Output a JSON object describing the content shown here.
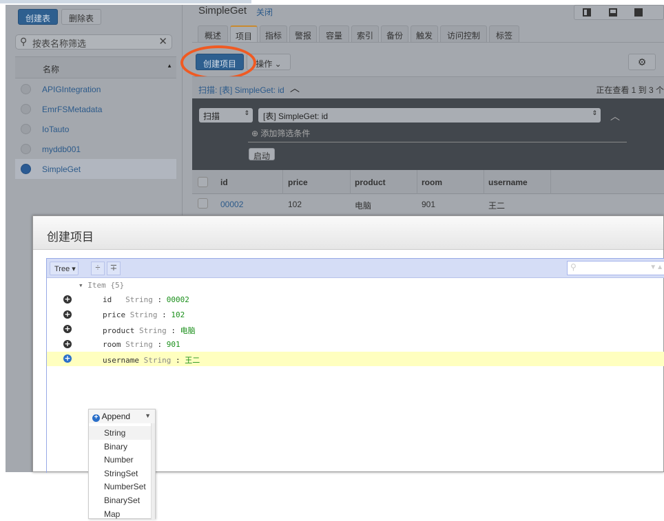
{
  "sidebar": {
    "create_table": "创建表",
    "delete_table": "删除表",
    "filter_placeholder": "按表名称筛选",
    "column_name": "名称",
    "tables": [
      {
        "name": "APIGIntegration",
        "selected": false
      },
      {
        "name": "EmrFSMetadata",
        "selected": false
      },
      {
        "name": "IoTauto",
        "selected": false
      },
      {
        "name": "myddb001",
        "selected": false
      },
      {
        "name": "SimpleGet",
        "selected": true
      }
    ]
  },
  "main": {
    "table_title": "SimpleGet",
    "close_link": "关闭",
    "tabs": [
      {
        "label": "概述"
      },
      {
        "label": "项目",
        "active": true
      },
      {
        "label": "指标"
      },
      {
        "label": "警报"
      },
      {
        "label": "容量"
      },
      {
        "label": "索引"
      },
      {
        "label": "备份"
      },
      {
        "label": "触发"
      },
      {
        "label": "访问控制"
      },
      {
        "label": "标签"
      }
    ],
    "create_item": "创建项目",
    "actions": "操作",
    "scan_summary": "扫描: [表] SimpleGet: id",
    "viewing": "正在查看 1 到 3 个",
    "scan_mode": "扫描",
    "scan_target": "[表] SimpleGet: id",
    "add_filter": "添加筛选条件",
    "start": "启动",
    "columns": [
      "id",
      "price",
      "product",
      "room",
      "username"
    ],
    "rows": [
      [
        "00002",
        "102",
        "电脑",
        "901",
        "王二"
      ]
    ]
  },
  "modal": {
    "title": "创建项目",
    "mode": "Tree",
    "root": "Item {5}",
    "fields": [
      {
        "key": "id",
        "type": "String",
        "value": "00002"
      },
      {
        "key": "price",
        "type": "String",
        "value": "102"
      },
      {
        "key": "product",
        "type": "String",
        "value": "电脑"
      },
      {
        "key": "room",
        "type": "String",
        "value": "901"
      },
      {
        "key": "username",
        "type": "String",
        "value": "王二"
      }
    ],
    "menu": {
      "label": "Append",
      "items": [
        "String",
        "Binary",
        "Number",
        "StringSet",
        "NumberSet",
        "BinarySet",
        "Map"
      ]
    }
  },
  "colors": {
    "highlight_annotation": "#f05a22",
    "value_green": "#1a8f1a",
    "row_highlight": "#ffffbf",
    "primary_button": "#2e5f8f"
  }
}
